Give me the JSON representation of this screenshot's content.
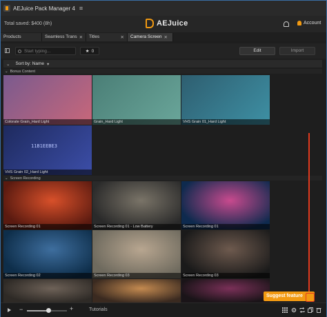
{
  "window": {
    "title": "AEJuice Pack Manager 4",
    "menu_icon": "hamburger-icon"
  },
  "header": {
    "total_saved": "Total saved: $400 (8h)",
    "brand": "AEJuice",
    "account": "Account"
  },
  "tabs": [
    {
      "label": "Products",
      "closable": false
    },
    {
      "label": "Seamless Trans",
      "closable": true
    },
    {
      "label": "Titles",
      "closable": true
    },
    {
      "label": "Camera Screen",
      "closable": true
    }
  ],
  "toolbar": {
    "search_placeholder": "Start typing...",
    "favorites_count": "0",
    "edit_label": "Edit",
    "import_label": "Import"
  },
  "sort": {
    "label": "Sort by: Name"
  },
  "sections": [
    {
      "name": "Bonus Content",
      "items": [
        {
          "caption": "Colorate Grain_Hard Light",
          "colors": [
            "#7a5a8e",
            "#c8677a"
          ]
        },
        {
          "caption": "Grain_Hard Light",
          "colors": [
            "#4a7e76",
            "#6aa69a"
          ]
        },
        {
          "caption": "VHS Grain 01_Hard Light",
          "colors": [
            "#2e5e70",
            "#3e90a4"
          ]
        },
        {
          "caption": "VHS Grain 02_Hard Light",
          "colors": [
            "#1e2a5e",
            "#3c4ea8"
          ],
          "overlay_text": "11B1EEBE3"
        }
      ]
    },
    {
      "name": "Screen Recording",
      "items": [
        {
          "caption": "Screen Recording 01",
          "colors": [
            "#5a1a10",
            "#d8502a"
          ]
        },
        {
          "caption": "Screen Recording 01 - Low Battery",
          "colors": [
            "#2a2a2a",
            "#7a7468"
          ]
        },
        {
          "caption": "Screen Recording 01",
          "colors": [
            "#0e2a4e",
            "#c84a8e"
          ]
        },
        {
          "caption": "Screen Recording 02",
          "colors": [
            "#0e2e4a",
            "#3e6e9e"
          ]
        },
        {
          "caption": "Screen Recording 03",
          "colors": [
            "#6e6a5e",
            "#b8a690"
          ]
        },
        {
          "caption": "Screen Recording 03",
          "colors": [
            "#1a1a1a",
            "#6e5a4e"
          ]
        },
        {
          "caption": "",
          "colors": [
            "#2e2a26",
            "#6e6258"
          ]
        },
        {
          "caption": "",
          "colors": [
            "#3a2a20",
            "#c48a50"
          ]
        },
        {
          "caption": "",
          "colors": [
            "#1a1418",
            "#7a3058"
          ]
        }
      ]
    }
  ],
  "suggest": {
    "label": "Suggest feature"
  },
  "bottom": {
    "tutorials": "Tutorials",
    "zoom_level": 0.55
  },
  "colors": {
    "accent": "#f29a12",
    "highlight": "#e23a1e"
  }
}
